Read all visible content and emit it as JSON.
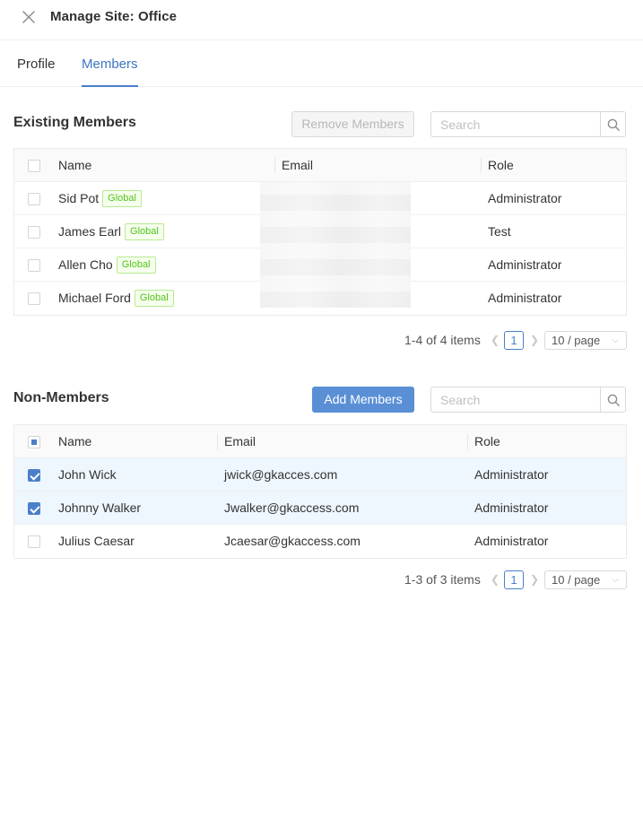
{
  "header": {
    "title": "Manage Site: Office"
  },
  "tabs": [
    {
      "label": "Profile",
      "active": false
    },
    {
      "label": "Members",
      "active": true
    }
  ],
  "existing": {
    "title": "Existing Members",
    "remove_label": "Remove Members",
    "search_placeholder": "Search",
    "columns": {
      "name": "Name",
      "email": "Email",
      "role": "Role"
    },
    "rows": [
      {
        "name": "Sid Pot",
        "tag": "Global",
        "role": "Administrator"
      },
      {
        "name": "James Earl",
        "tag": "Global",
        "role": "Test"
      },
      {
        "name": "Allen Cho",
        "tag": "Global",
        "role": "Administrator"
      },
      {
        "name": "Michael Ford",
        "tag": "Global",
        "role": "Administrator"
      }
    ],
    "pagination": {
      "total": "1-4 of 4 items",
      "current": "1",
      "page_size": "10 / page"
    }
  },
  "nonmembers": {
    "title": "Non-Members",
    "add_label": "Add Members",
    "search_placeholder": "Search",
    "columns": {
      "name": "Name",
      "email": "Email",
      "role": "Role"
    },
    "rows": [
      {
        "name": "John Wick",
        "email": "jwick@gkacces.com",
        "role": "Administrator",
        "checked": true
      },
      {
        "name": "Johnny Walker",
        "email": "Jwalker@gkaccess.com",
        "role": "Administrator",
        "checked": true
      },
      {
        "name": "Julius Caesar",
        "email": "Jcaesar@gkaccess.com",
        "role": "Administrator",
        "checked": false
      }
    ],
    "pagination": {
      "total": "1-3 of 3 items",
      "current": "1",
      "page_size": "10 / page"
    }
  },
  "colors": {
    "accent": "#4a7fc9",
    "primary_button": "#5a8fd6",
    "tag_green": "#52c41a",
    "selected_row": "#eef6fe"
  }
}
